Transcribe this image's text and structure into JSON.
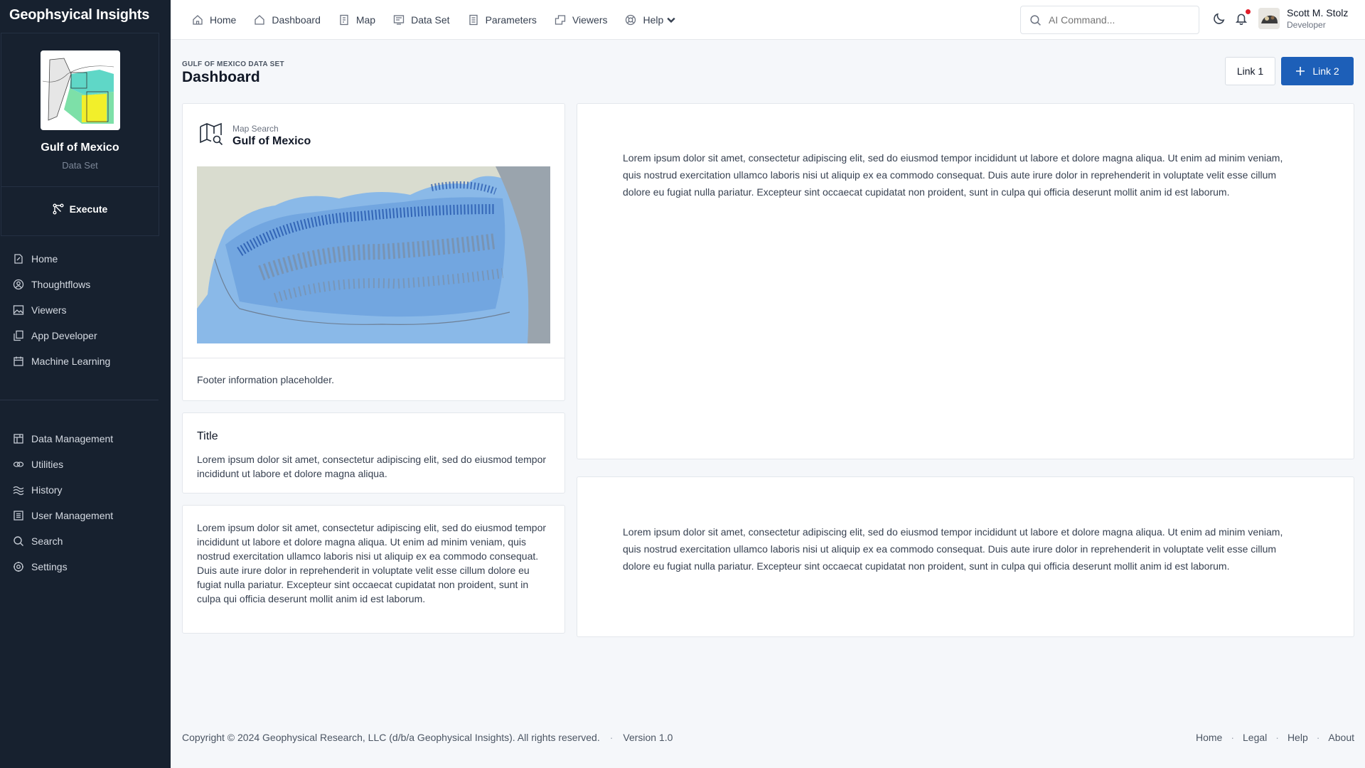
{
  "app": {
    "brand": "Geophsyical Insights"
  },
  "sidebar": {
    "dataset_title": "Gulf of Mexico",
    "dataset_subtitle": "Data Set",
    "execute_label": "Execute",
    "items": [
      {
        "label": "Home",
        "icon": "home-doc-icon"
      },
      {
        "label": "Thoughtflows",
        "icon": "user-circle-icon"
      },
      {
        "label": "Viewers",
        "icon": "image-icon"
      },
      {
        "label": "App Developer",
        "icon": "copy-icon"
      },
      {
        "label": "Machine Learning",
        "icon": "calendar-icon"
      }
    ],
    "items2": [
      {
        "label": "Data Management",
        "icon": "grid-icon"
      },
      {
        "label": "Utilities",
        "icon": "link-icon"
      },
      {
        "label": "History",
        "icon": "waves-icon"
      },
      {
        "label": "User Management",
        "icon": "list-icon"
      },
      {
        "label": "Search",
        "icon": "search-icon"
      },
      {
        "label": "Settings",
        "icon": "gear-icon"
      }
    ]
  },
  "topbar": {
    "nav": [
      {
        "label": "Home",
        "icon": "home-icon"
      },
      {
        "label": "Dashboard",
        "icon": "house-icon"
      },
      {
        "label": "Map",
        "icon": "map-doc-icon"
      },
      {
        "label": "Data Set",
        "icon": "dataset-icon"
      },
      {
        "label": "Parameters",
        "icon": "sliders-icon"
      },
      {
        "label": "Viewers",
        "icon": "viewer-icon"
      },
      {
        "label": "Help",
        "icon": "lifebuoy-icon"
      }
    ],
    "search_placeholder": "AI Command...",
    "user_name": "Scott M. Stolz",
    "user_role": "Developer"
  },
  "header": {
    "breadcrumb": "GULF OF MEXICO DATA SET",
    "title": "Dashboard",
    "link1": "Link 1",
    "link2": "Link 2"
  },
  "map_card": {
    "kicker": "Map Search",
    "title": "Gulf of Mexico",
    "footer": "Footer information placeholder."
  },
  "title_card": {
    "title": "Title",
    "body": "Lorem ipsum dolor sit amet, consectetur adipiscing elit, sed do eiusmod tempor incididunt ut labore et dolore magna aliqua."
  },
  "text_card": {
    "body": "Lorem ipsum dolor sit amet, consectetur adipiscing elit, sed do eiusmod tempor incididunt ut labore et dolore magna aliqua. Ut enim ad minim veniam, quis nostrud exercitation ullamco laboris nisi ut aliquip ex ea commodo consequat. Duis aute irure dolor in reprehenderit in voluptate velit esse cillum dolore eu fugiat nulla pariatur. Excepteur sint occaecat cupidatat non proident, sunt in culpa qui officia deserunt mollit anim id est laborum."
  },
  "big_card": {
    "body": "Lorem ipsum dolor sit amet, consectetur adipiscing elit, sed do eiusmod tempor incididunt ut labore et dolore magna aliqua. Ut enim ad minim veniam, quis nostrud exercitation ullamco laboris nisi ut aliquip ex ea commodo consequat. Duis aute irure dolor in reprehenderit in voluptate velit esse cillum dolore eu fugiat nulla pariatur. Excepteur sint occaecat cupidatat non proident, sunt in culpa qui officia deserunt mollit anim id est laborum."
  },
  "big_card2": {
    "body": "Lorem ipsum dolor sit amet, consectetur adipiscing elit, sed do eiusmod tempor incididunt ut labore et dolore magna aliqua. Ut enim ad minim veniam, quis nostrud exercitation ullamco laboris nisi ut aliquip ex ea commodo consequat. Duis aute irure dolor in reprehenderit in voluptate velit esse cillum dolore eu fugiat nulla pariatur. Excepteur sint occaecat cupidatat non proident, sunt in culpa qui officia deserunt mollit anim id est laborum."
  },
  "footer": {
    "copyright": "Copyright © 2024 Geophysical Research, LLC (d/b/a Geophysical Insights). All rights reserved.",
    "version": "Version 1.0",
    "links": [
      "Home",
      "Legal",
      "Help",
      "About"
    ]
  },
  "colors": {
    "sidebar": "#17212f",
    "primary": "#1d5fb8",
    "notification": "#e11d2a"
  }
}
